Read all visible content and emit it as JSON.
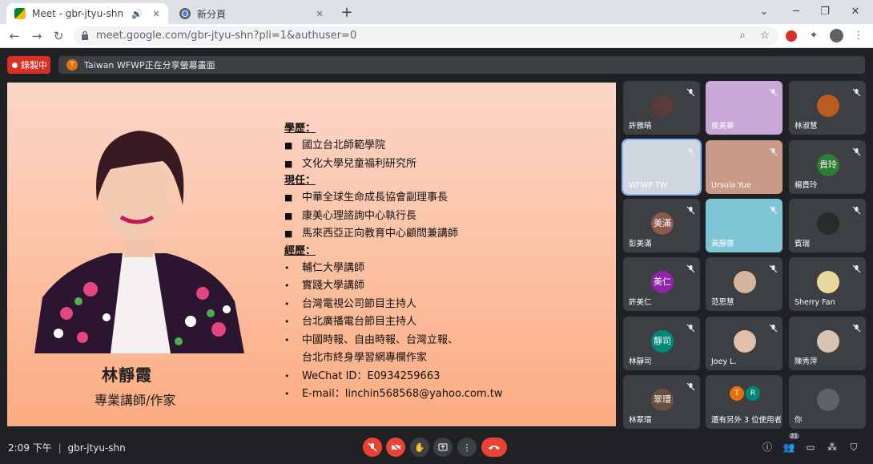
{
  "browser": {
    "tabs": [
      {
        "title": "Meet - gbr-jtyu-shn",
        "active": true
      },
      {
        "title": "新分頁",
        "active": false
      }
    ],
    "url": "meet.google.com/gbr-jtyu-shn?pli=1&authuser=0"
  },
  "meet": {
    "recording_label": "錄製中",
    "share_avatar": "T",
    "share_banner": "Taiwan WFWP正在分享螢幕畫面",
    "time": "2:09 下午",
    "separator": "|",
    "meeting_code": "gbr-jtyu-shn",
    "participants_count": "21"
  },
  "slide": {
    "name": "林靜霞",
    "role": "專業講師/作家",
    "headings": {
      "education": "學歷：",
      "current": "現任：",
      "experience": "經歷："
    },
    "bullet_square": "■",
    "bullet_dot": "•",
    "education": [
      "國立台北師範學院",
      "文化大學兒童福利研究所"
    ],
    "current": [
      "中華全球生命成長協會副理事長",
      "康美心理諮詢中心執行長",
      "馬來西亞正向教育中心顧問兼講師"
    ],
    "experience": [
      "輔仁大學講師",
      "實踐大學講師",
      "台灣電視公司節目主持人",
      "台北廣播電台節目主持人",
      "中國時報、自由時報、台灣立報、"
    ],
    "experience_cont": "台北市終身學習網專欄作家",
    "contacts": [
      "WeChat ID：E0934259663",
      "E-mail：linchin568568@yahoo.com.tw"
    ]
  },
  "participants": [
    {
      "name": "許雅晴",
      "avatar": "",
      "color": "#5b3a3a"
    },
    {
      "name": "侯美華",
      "avatar": "",
      "color": "#c9a8d8"
    },
    {
      "name": "林淑慧",
      "avatar": "",
      "color": "#b85c20"
    },
    {
      "name": "WFWP TW",
      "avatar": "",
      "color": "#cfd6e0"
    },
    {
      "name": "Ursula Yue",
      "avatar": "",
      "color": "#c99a88"
    },
    {
      "name": "楊貴玲",
      "avatar": "貴玲",
      "color": "#2e7d32"
    },
    {
      "name": "彭美滿",
      "avatar": "美滿",
      "color": "#8d5a4a"
    },
    {
      "name": "黃靜惠",
      "avatar": "",
      "color": "#7ec6d6"
    },
    {
      "name": "賓瑞",
      "avatar": "",
      "color": "#2a2a2a"
    },
    {
      "name": "許美仁",
      "avatar": "美仁",
      "color": "#8e24aa"
    },
    {
      "name": "范思慧",
      "avatar": "",
      "color": "#d7b49e"
    },
    {
      "name": "Sherry Fan",
      "avatar": "",
      "color": "#e8d7a0"
    },
    {
      "name": "林靜司",
      "avatar": "靜司",
      "color": "#00897b"
    },
    {
      "name": "Joey L.",
      "avatar": "",
      "color": "#e0c0a8"
    },
    {
      "name": "陳秀萍",
      "avatar": "",
      "color": "#d9c3b0"
    },
    {
      "name": "林翠環",
      "avatar": "翠環",
      "color": "#6d4c41"
    },
    {
      "name": "還有另外 3 位使用者",
      "avatar": "",
      "color": ""
    },
    {
      "name": "你",
      "avatar": "",
      "color": "#5f6368"
    }
  ],
  "others_avatars": [
    "T",
    "R"
  ]
}
